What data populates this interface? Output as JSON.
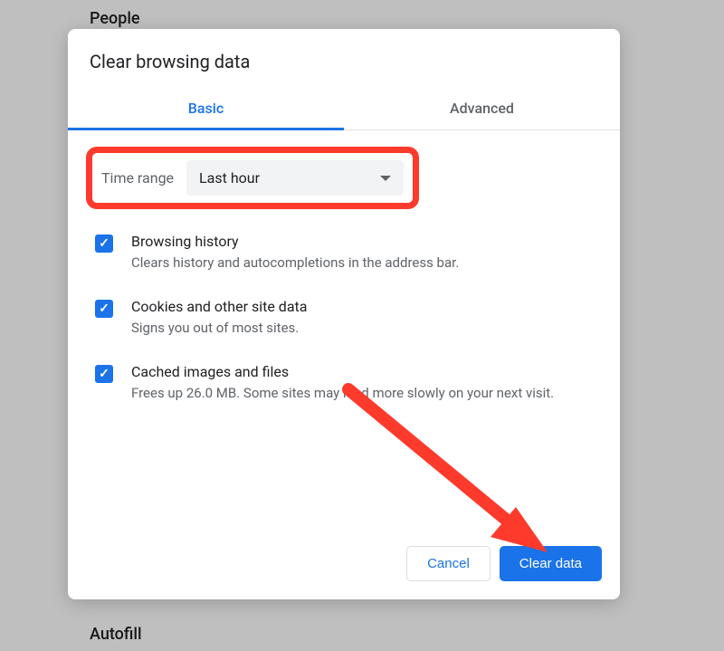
{
  "background": {
    "people_label": "People",
    "autofill_label": "Autofill"
  },
  "dialog": {
    "title": "Clear browsing data",
    "tabs": {
      "basic": "Basic",
      "advanced": "Advanced"
    },
    "time_range": {
      "label": "Time range",
      "value": "Last hour"
    },
    "items": [
      {
        "title": "Browsing history",
        "description": "Clears history and autocompletions in the address bar.",
        "checked": true
      },
      {
        "title": "Cookies and other site data",
        "description": "Signs you out of most sites.",
        "checked": true
      },
      {
        "title": "Cached images and files",
        "description": "Frees up 26.0 MB. Some sites may load more slowly on your next visit.",
        "checked": true
      }
    ],
    "buttons": {
      "cancel": "Cancel",
      "clear": "Clear data"
    }
  },
  "annotation": {
    "highlight_color": "#fd3a2c"
  }
}
